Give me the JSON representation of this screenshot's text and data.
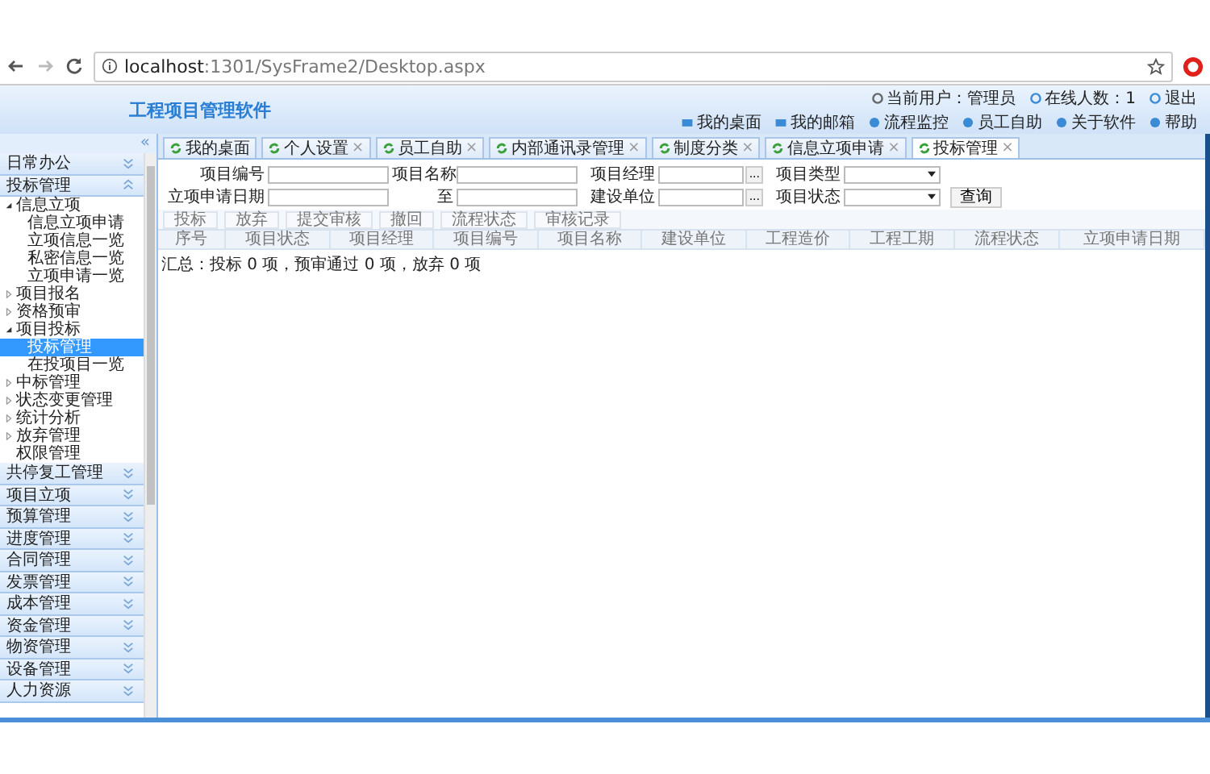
{
  "browser": {
    "url": "**localhost**:1301/SysFrame2/Desktop.aspx"
  },
  "app": {
    "title": "工程项目管理软件",
    "user_info": [
      {
        "kind": "user",
        "label": "当前用户：管理员"
      },
      {
        "kind": "online",
        "label": "在线人数：1"
      },
      {
        "kind": "exit",
        "label": "退出"
      }
    ],
    "links": [
      {
        "kind": "desk",
        "label": "我的桌面"
      },
      {
        "kind": "mail",
        "label": "我的邮箱"
      },
      {
        "kind": "flow",
        "label": "流程监控"
      },
      {
        "kind": "staff",
        "label": "员工自助"
      },
      {
        "kind": "about",
        "label": "关于软件"
      },
      {
        "kind": "help",
        "label": "帮助"
      }
    ]
  },
  "sidebar": {
    "collapse": "«",
    "sections": [
      {
        "label": "日常办公",
        "expanded": false
      },
      {
        "label": "投标管理",
        "expanded": true,
        "tree": [
          {
            "label": "信息立项",
            "kind": "folder",
            "expanded": true,
            "selected": false,
            "children": [
              {
                "label": "信息立项申请",
                "kind": "leaf",
                "selected": false
              },
              {
                "label": "立项信息一览",
                "kind": "leaf",
                "selected": false
              },
              {
                "label": "私密信息一览",
                "kind": "leaf",
                "selected": false
              },
              {
                "label": "立项申请一览",
                "kind": "leaf",
                "selected": false
              }
            ]
          },
          {
            "label": "项目报名",
            "kind": "folder",
            "expanded": false,
            "selected": false
          },
          {
            "label": "资格预审",
            "kind": "folder",
            "expanded": false,
            "selected": false
          },
          {
            "label": "项目投标",
            "kind": "folder",
            "expanded": true,
            "selected": false,
            "children": [
              {
                "label": "投标管理",
                "kind": "leaf",
                "selected": true
              },
              {
                "label": "在投项目一览",
                "kind": "leaf",
                "selected": false
              }
            ]
          },
          {
            "label": "中标管理",
            "kind": "folder",
            "expanded": false,
            "selected": false
          },
          {
            "label": "状态变更管理",
            "kind": "folder",
            "expanded": false,
            "selected": false
          },
          {
            "label": "统计分析",
            "kind": "folder",
            "expanded": false,
            "selected": false
          },
          {
            "label": "放弃管理",
            "kind": "folder",
            "expanded": false,
            "selected": false
          },
          {
            "label": "权限管理",
            "kind": "leaf",
            "selected": false
          }
        ]
      },
      {
        "label": "共停复工管理",
        "expanded": false
      },
      {
        "label": "项目立项",
        "expanded": false
      },
      {
        "label": "预算管理",
        "expanded": false
      },
      {
        "label": "进度管理",
        "expanded": false
      },
      {
        "label": "合同管理",
        "expanded": false
      },
      {
        "label": "发票管理",
        "expanded": false
      },
      {
        "label": "成本管理",
        "expanded": false
      },
      {
        "label": "资金管理",
        "expanded": false
      },
      {
        "label": "物资管理",
        "expanded": false
      },
      {
        "label": "设备管理",
        "expanded": false
      },
      {
        "label": "人力资源",
        "expanded": false
      }
    ]
  },
  "tabs": [
    {
      "label": "我的桌面",
      "selected": false,
      "closable": false
    },
    {
      "label": "个人设置",
      "selected": false,
      "closable": true
    },
    {
      "label": "员工自助",
      "selected": false,
      "closable": true
    },
    {
      "label": "内部通讯录管理",
      "selected": false,
      "closable": true
    },
    {
      "label": "制度分类",
      "selected": false,
      "closable": true
    },
    {
      "label": "信息立项申请",
      "selected": false,
      "closable": true
    },
    {
      "label": "投标管理",
      "selected": true,
      "closable": true
    }
  ],
  "close_mark": "×",
  "search_form": [
    [
      {
        "kind": "label",
        "text": "项目编号"
      },
      {
        "kind": "input"
      },
      {
        "kind": "label",
        "text": "项目名称"
      },
      {
        "kind": "input"
      },
      {
        "kind": "label",
        "text": "项目经理"
      },
      {
        "kind": "picker",
        "text": "..."
      },
      {
        "kind": "label",
        "text": "项目类型"
      },
      {
        "kind": "select"
      }
    ],
    [
      {
        "kind": "label",
        "text": "立项申请日期"
      },
      {
        "kind": "input"
      },
      {
        "kind": "label",
        "text": "至"
      },
      {
        "kind": "input"
      },
      {
        "kind": "label",
        "text": "建设单位"
      },
      {
        "kind": "picker",
        "text": "..."
      },
      {
        "kind": "label",
        "text": "项目状态"
      },
      {
        "kind": "select"
      },
      {
        "kind": "button",
        "text": "查询"
      }
    ]
  ],
  "toolbar": [
    "投标",
    "放弃",
    "提交审核",
    "撤回",
    "流程状态",
    "审核记录"
  ],
  "table": {
    "columns": [
      "序号",
      "项目状态",
      "项目经理",
      "项目编号",
      "项目名称",
      "建设单位",
      "工程造价",
      "工程工期",
      "流程状态",
      "立项申请日期"
    ],
    "summary": "汇总：投标 0 项，预审通过 0 项，放弃 0 项"
  }
}
